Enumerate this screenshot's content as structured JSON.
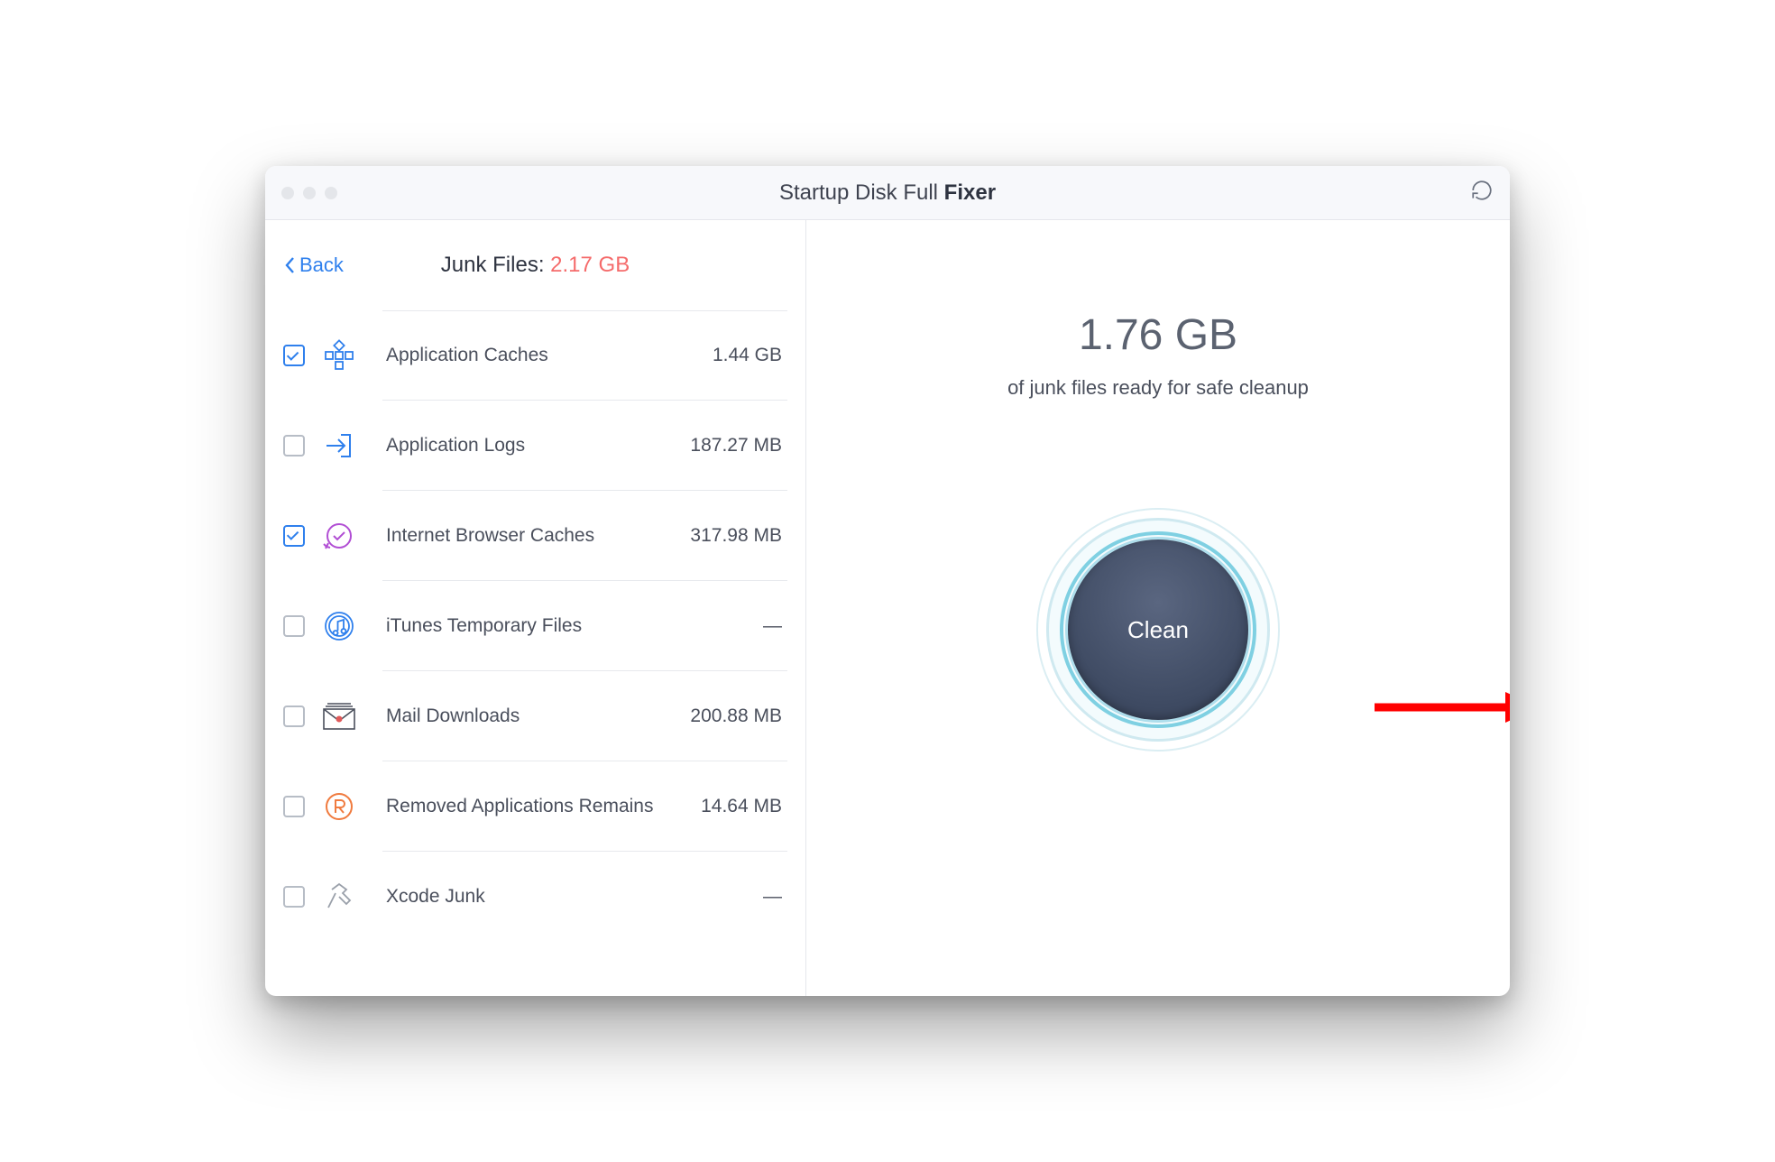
{
  "titlebar": {
    "title_prefix": "Startup Disk Full ",
    "title_bold": "Fixer"
  },
  "left": {
    "back_label": "Back",
    "junk_label": "Junk Files: ",
    "junk_size": "2.17 GB",
    "items": [
      {
        "label": "Application Caches",
        "size": "1.44 GB",
        "checked": true,
        "icon": "grid-icon",
        "icon_color": "#2f80ed"
      },
      {
        "label": "Application Logs",
        "size": "187.27 MB",
        "checked": false,
        "icon": "arrow-in-icon",
        "icon_color": "#2f80ed"
      },
      {
        "label": "Internet Browser Caches",
        "size": "317.98 MB",
        "checked": true,
        "icon": "circle-check-icon",
        "icon_color": "#b14ed4"
      },
      {
        "label": "iTunes Temporary Files",
        "size": "—",
        "checked": false,
        "icon": "music-note-icon",
        "icon_color": "#2f80ed"
      },
      {
        "label": "Mail Downloads",
        "size": "200.88 MB",
        "checked": false,
        "icon": "envelope-icon",
        "icon_color": "#4a4f5c"
      },
      {
        "label": "Removed Applications Remains",
        "size": "14.64 MB",
        "checked": false,
        "icon": "r-circle-icon",
        "icon_color": "#f07b3f"
      },
      {
        "label": "Xcode Junk",
        "size": "—",
        "checked": false,
        "icon": "hammer-icon",
        "icon_color": "#9aa0aa"
      }
    ]
  },
  "right": {
    "selected_size": "1.76 GB",
    "subtext": "of junk files ready for safe cleanup",
    "clean_label": "Clean"
  }
}
